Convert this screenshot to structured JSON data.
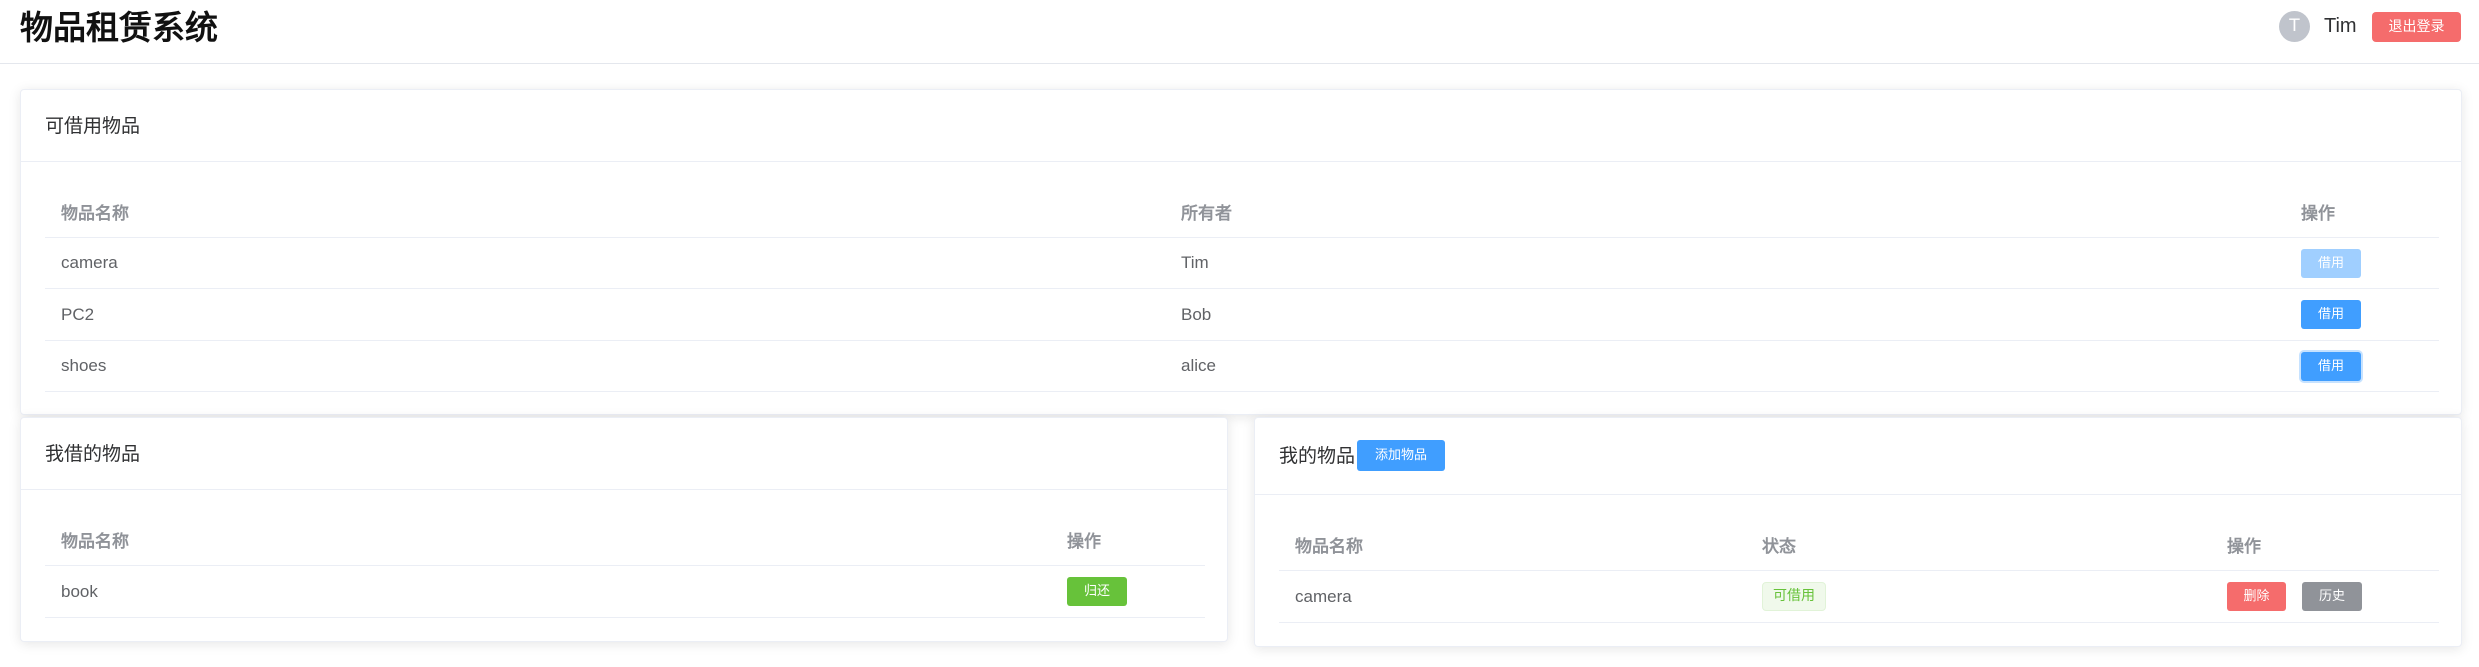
{
  "header": {
    "app_title": "物品租赁系统",
    "avatar_letter": "T",
    "username": "Tim",
    "logout_label": "退出登录"
  },
  "available": {
    "title": "可借用物品",
    "columns": [
      "物品名称",
      "所有者",
      "操作"
    ],
    "rows": [
      {
        "name": "camera",
        "owner": "Tim",
        "action": "借用",
        "state": "disabled"
      },
      {
        "name": "PC2",
        "owner": "Bob",
        "action": "借用",
        "state": "enabled"
      },
      {
        "name": "shoes",
        "owner": "alice",
        "action": "借用",
        "state": "focused"
      }
    ]
  },
  "borrowed": {
    "title": "我借的物品",
    "columns": [
      "物品名称",
      "操作"
    ],
    "rows": [
      {
        "name": "book",
        "action": "归还"
      }
    ]
  },
  "mine": {
    "title": "我的物品",
    "add_label": "添加物品",
    "columns": [
      "物品名称",
      "状态",
      "操作"
    ],
    "rows": [
      {
        "name": "camera",
        "status": "可借用",
        "delete_label": "删除",
        "history_label": "历史"
      }
    ]
  },
  "colors": {
    "primary": "#409eff",
    "primary_disabled": "#a0cfff",
    "success": "#67c23a",
    "danger": "#f56c6c",
    "info": "#909399"
  }
}
